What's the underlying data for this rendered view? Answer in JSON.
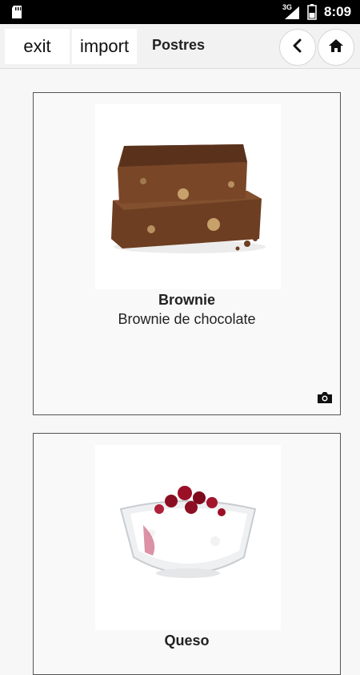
{
  "status_bar": {
    "network": "3G",
    "time": "8:09"
  },
  "toolbar": {
    "exit_label": "exit",
    "import_label": "import",
    "title": "Postres"
  },
  "cards": [
    {
      "name": "Brownie",
      "description": "Brownie de chocolate"
    },
    {
      "name": "Queso",
      "description": ""
    }
  ]
}
